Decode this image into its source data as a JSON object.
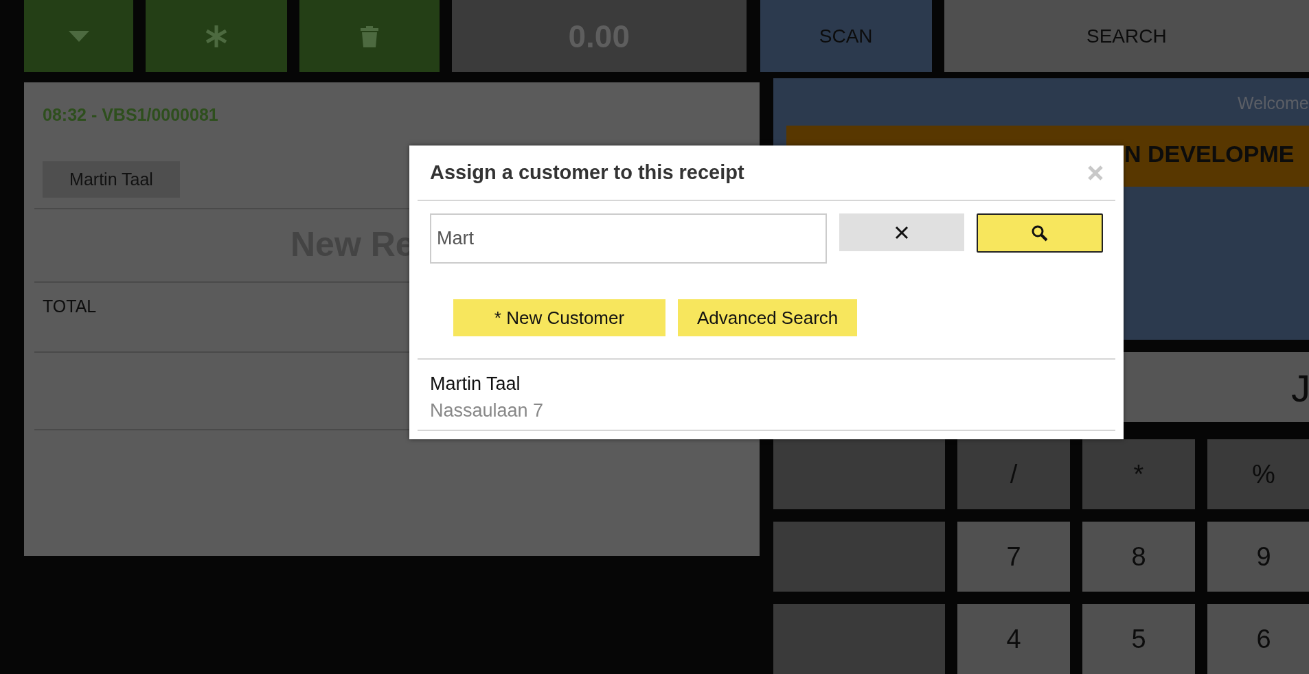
{
  "toolbar": {
    "buttons": [
      {
        "kind": "caret"
      },
      {
        "kind": "asterisk"
      },
      {
        "kind": "trash"
      }
    ],
    "amount": "0.00",
    "scan": "SCAN",
    "search": "SEARCH"
  },
  "receipt": {
    "header": "08:32 - VBS1/0000081",
    "customer": "Martin Taal",
    "title": "New Re",
    "total_label": "TOTAL"
  },
  "side": {
    "welcome": "Welcome",
    "banner": "N DEVELOPME",
    "display": "J"
  },
  "keypad": [
    [
      {
        "kind": "blank"
      },
      {
        "kind": "operator",
        "label": "/"
      },
      {
        "kind": "operator",
        "label": "*"
      },
      {
        "kind": "operator",
        "label": "%"
      }
    ],
    [
      {
        "kind": "blank"
      },
      {
        "kind": "digit",
        "label": "7"
      },
      {
        "kind": "digit",
        "label": "8"
      },
      {
        "kind": "digit",
        "label": "9"
      }
    ],
    [
      {
        "kind": "blank"
      },
      {
        "kind": "digit",
        "label": "4"
      },
      {
        "kind": "digit",
        "label": "5"
      },
      {
        "kind": "digit",
        "label": "6"
      }
    ]
  ],
  "dialog": {
    "title": "Assign a customer to this receipt",
    "search": {
      "value": "Mart"
    },
    "actions": [
      "* New Customer",
      "Advanced Search"
    ],
    "results": [
      {
        "name": "Martin Taal",
        "address": "Nassaulaan 7"
      }
    ]
  }
}
